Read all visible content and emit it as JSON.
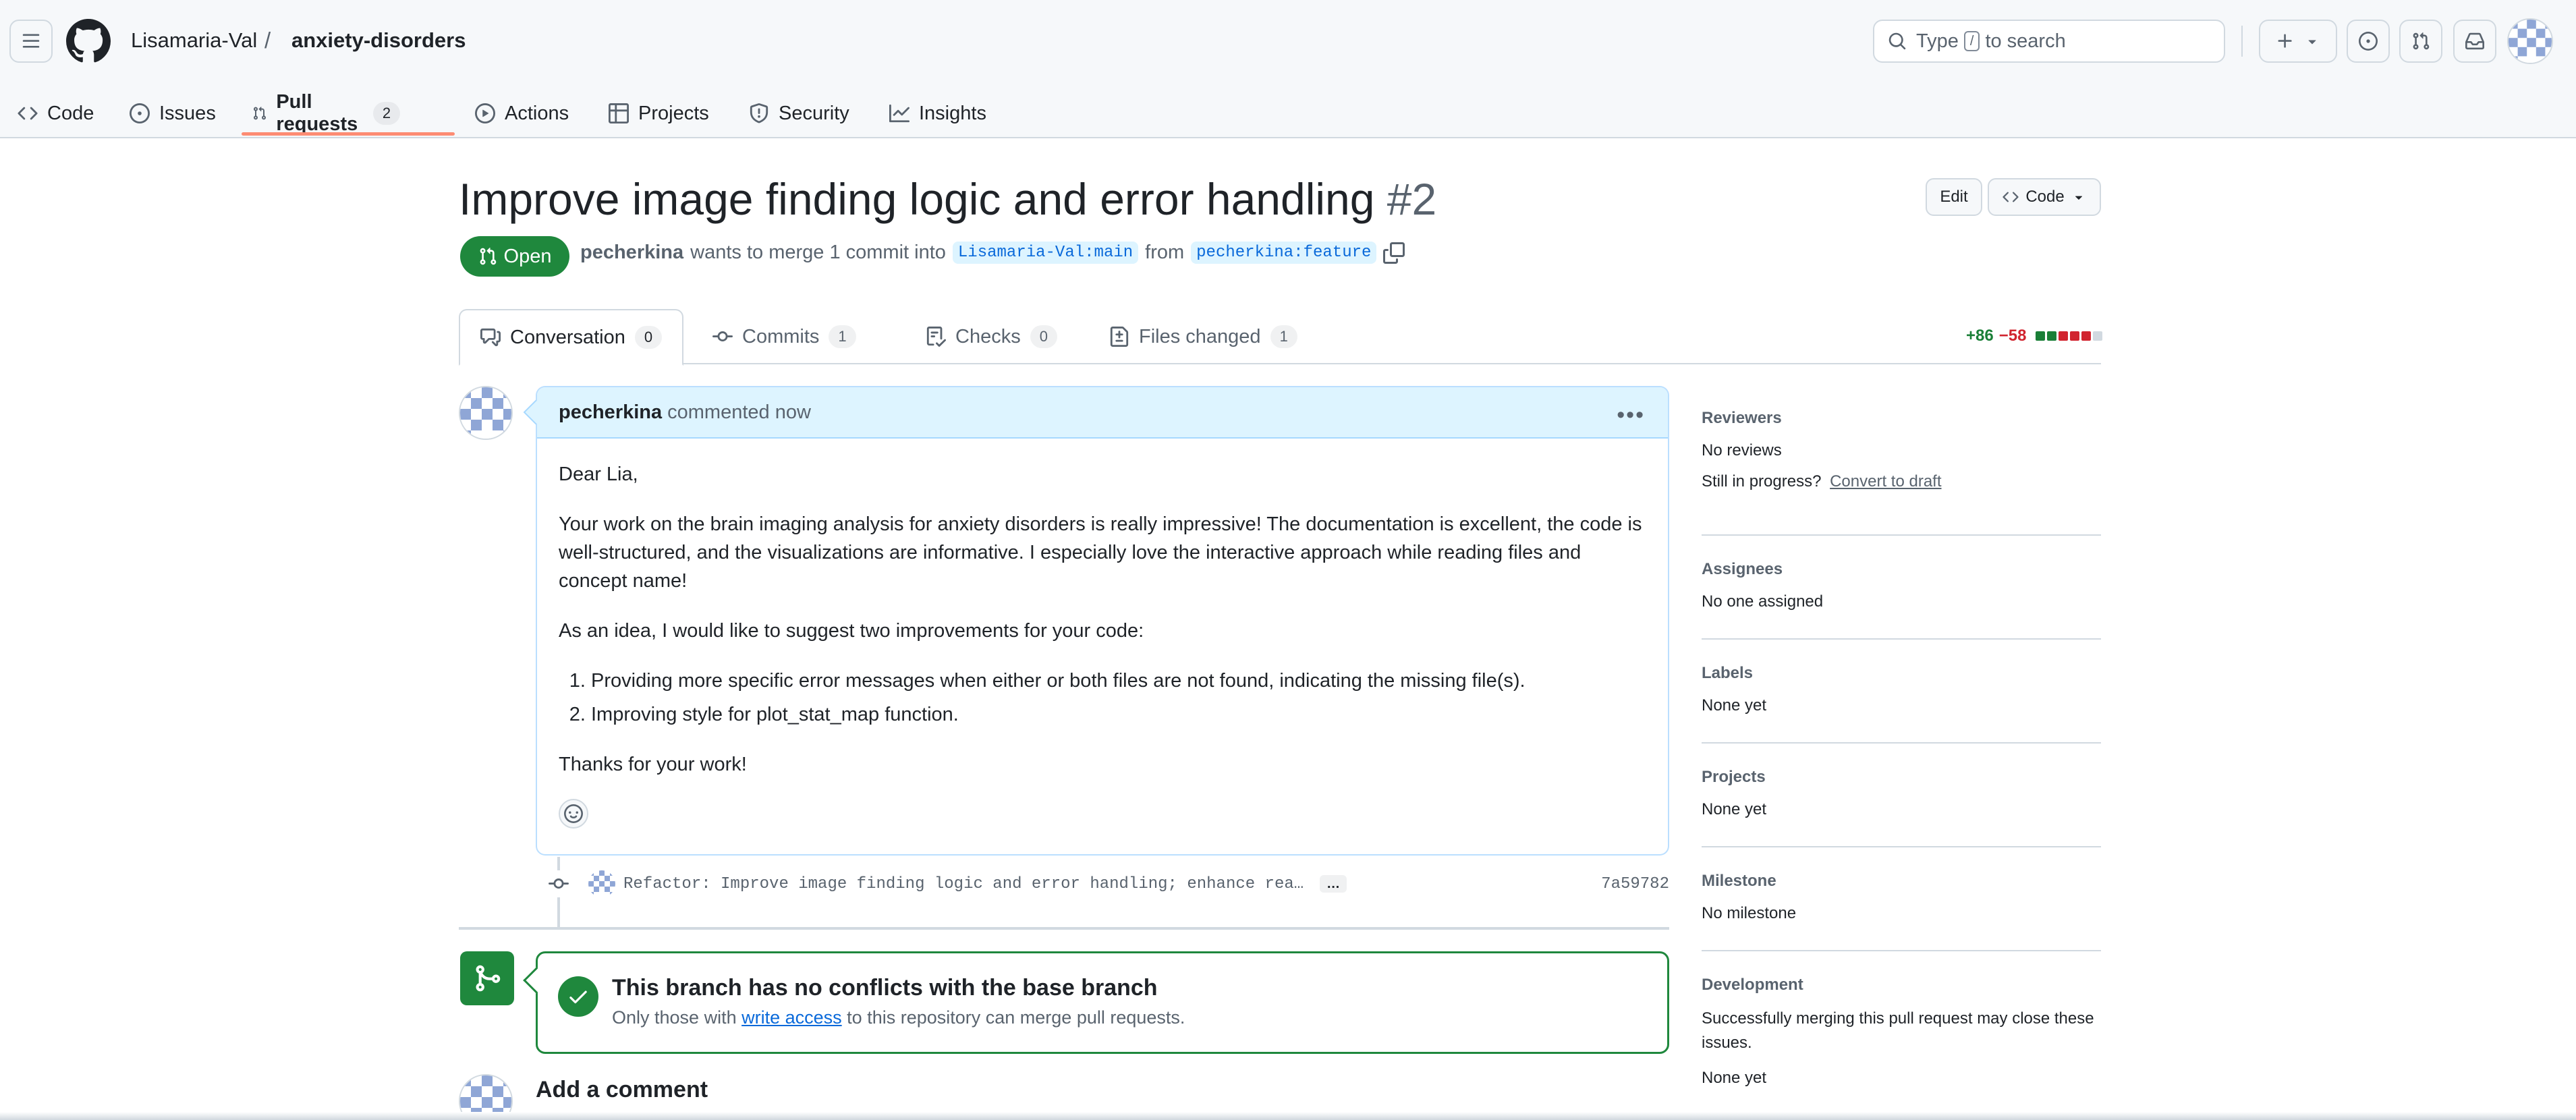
{
  "repo": {
    "owner": "Lisamaria-Val",
    "separator": "/",
    "name": "anxiety-disorders"
  },
  "search": {
    "text_before": "Type",
    "key": "/",
    "text_after": "to search"
  },
  "nav": {
    "items": [
      {
        "label": "Code",
        "icon": "code-icon"
      },
      {
        "label": "Issues",
        "icon": "issue-opened-icon"
      },
      {
        "label": "Pull requests",
        "icon": "git-pull-request-icon",
        "count": "2",
        "active": true
      },
      {
        "label": "Actions",
        "icon": "play-icon"
      },
      {
        "label": "Projects",
        "icon": "table-icon"
      },
      {
        "label": "Security",
        "icon": "shield-icon"
      },
      {
        "label": "Insights",
        "icon": "graph-icon"
      }
    ]
  },
  "pr": {
    "title": "Improve image finding logic and error handling",
    "number": "#2",
    "edit_label": "Edit",
    "code_label": "Code",
    "state": "Open",
    "author": "pecherkina",
    "meta_text": "wants to merge 1 commit into",
    "base_branch": "Lisamaria-Val:main",
    "from_text": "from",
    "head_branch": "pecherkina:feature"
  },
  "tabs": [
    {
      "label": "Conversation",
      "count": "0",
      "icon": "comment-discussion-icon",
      "active": true
    },
    {
      "label": "Commits",
      "count": "1",
      "icon": "git-commit-icon"
    },
    {
      "label": "Checks",
      "count": "0",
      "icon": "checklist-icon"
    },
    {
      "label": "Files changed",
      "count": "1",
      "icon": "file-diff-icon"
    }
  ],
  "diffstat": {
    "additions": "+86",
    "deletions": "−58",
    "blocks": [
      "#1a7f37",
      "#1a7f37",
      "#d1242f",
      "#d1242f",
      "#d1242f",
      "#d1d9e0"
    ]
  },
  "comment": {
    "author": "pecherkina",
    "action": "commented now",
    "greeting": "Dear Lia,",
    "paragraph1": "Your work on the brain imaging analysis for anxiety disorders is really impressive! The documentation is excellent, the code is well-structured, and the visualizations are informative. I especially love the interactive approach while reading files and concept name!",
    "paragraph2": "As an idea, I would like to suggest two improvements for your code:",
    "list": [
      "Providing more specific error messages when either or both files are not found, indicating the missing file(s).",
      "Improving style for plot_stat_map function."
    ],
    "closing": "Thanks for your work!"
  },
  "commit": {
    "message": "Refactor: Improve image finding logic and error handling; enhance rea…",
    "more": "…",
    "sha": "7a59782"
  },
  "merge": {
    "title": "This branch has no conflicts with the base branch",
    "sub_before": "Only those with",
    "sub_link": "write access",
    "sub_after": "to this repository can merge pull requests."
  },
  "add_comment": "Add a comment",
  "sidebar": {
    "reviewers": {
      "title": "Reviewers",
      "value": "No reviews",
      "progress_text": "Still in progress?",
      "convert_link": "Convert to draft"
    },
    "assignees": {
      "title": "Assignees",
      "value": "No one assigned"
    },
    "labels": {
      "title": "Labels",
      "value": "None yet"
    },
    "projects": {
      "title": "Projects",
      "value": "None yet"
    },
    "milestone": {
      "title": "Milestone",
      "value": "No milestone"
    },
    "development": {
      "title": "Development",
      "description": "Successfully merging this pull request may close these issues.",
      "value": "None yet"
    }
  },
  "colors": {
    "accent_green": "#1f883d",
    "link_blue": "#0969da",
    "nav_underline": "#fd8c73",
    "comment_header": "#ddf4ff"
  }
}
